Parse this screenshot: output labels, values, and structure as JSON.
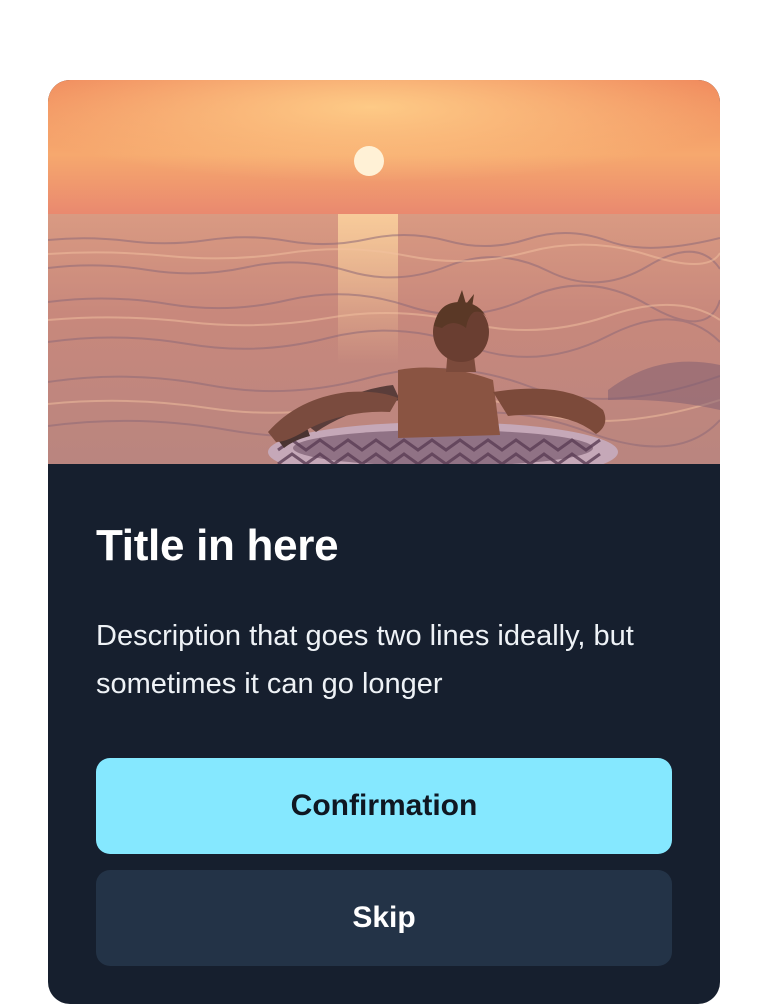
{
  "card": {
    "image_alt": "Person relaxing on an inflatable ring in the sea at sunset",
    "title": "Title in here",
    "description": "Description that goes two lines ideally, but sometimes it can go longer",
    "primary_button": "Confirmation",
    "secondary_button": "Skip"
  },
  "colors": {
    "card_background": "#161f2e",
    "primary_button": "#85e8ff",
    "secondary_button": "#233347",
    "page_background": "#ffffff"
  }
}
